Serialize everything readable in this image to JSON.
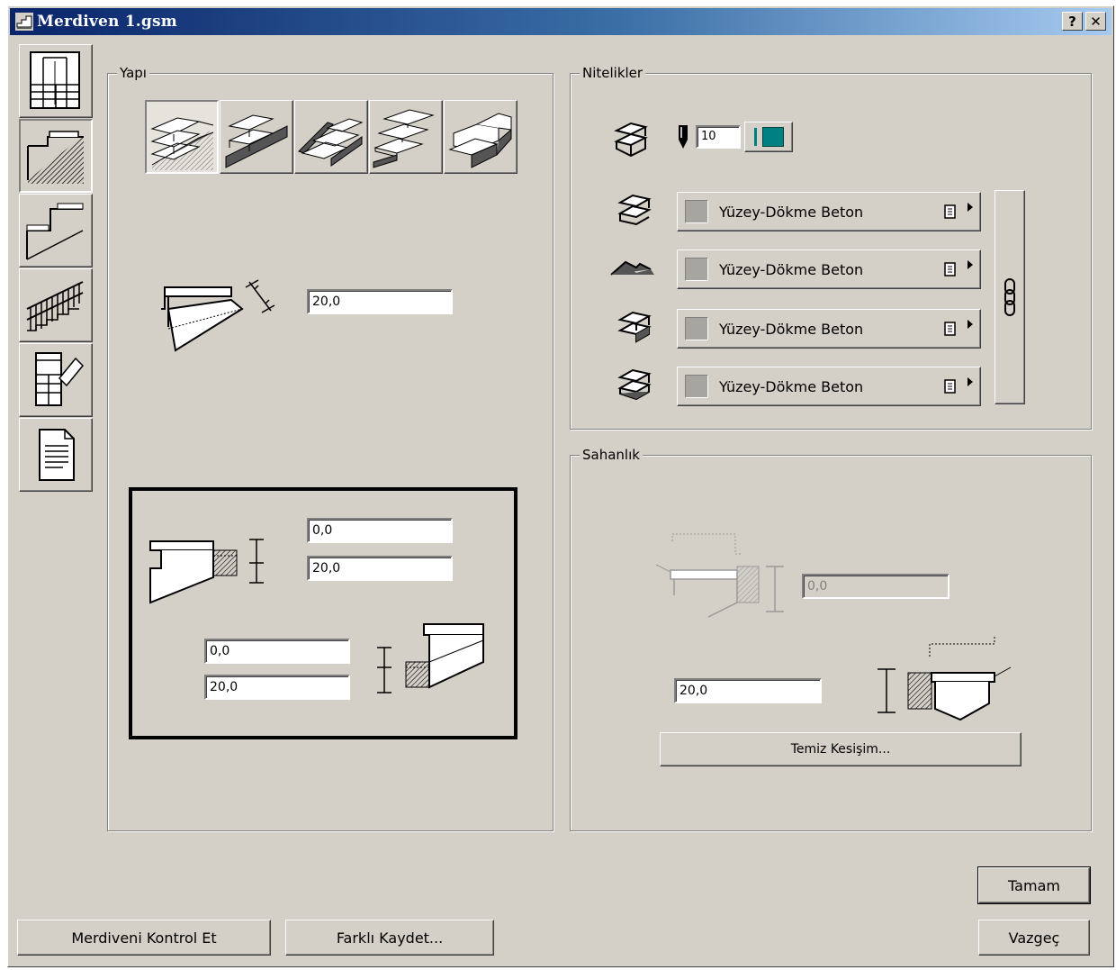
{
  "window": {
    "title": "Merdiven 1.gsm",
    "help_label": "?",
    "close_label": "✕"
  },
  "tabs": [
    {
      "name": "plan-view",
      "icon": "plan-view-icon"
    },
    {
      "name": "structure",
      "icon": "stair-structure-icon",
      "active": true
    },
    {
      "name": "stringer",
      "icon": "stringer-icon"
    },
    {
      "name": "railing",
      "icon": "railing-icon"
    },
    {
      "name": "plan-symbol",
      "icon": "plan-edit-icon"
    },
    {
      "name": "listing",
      "icon": "document-icon"
    }
  ],
  "yapi": {
    "title": "Yapı",
    "structure_types": [
      {
        "name": "solid-stair",
        "selected": true
      },
      {
        "name": "stringer-stair",
        "selected": false
      },
      {
        "name": "open-tread-stair",
        "selected": false
      },
      {
        "name": "cantilever-stair",
        "selected": false
      },
      {
        "name": "block-stair",
        "selected": false
      }
    ],
    "thickness": "20,0",
    "bottom_top": "0,0",
    "bottom_bottom": "20,0",
    "top_top": "0,0",
    "top_bottom": "20,0"
  },
  "nitelikler": {
    "title": "Nitelikler",
    "pen_value": "10",
    "accent_color": "#008080",
    "materials": [
      {
        "label": "Yüzey-Dökme Beton"
      },
      {
        "label": "Yüzey-Dökme Beton"
      },
      {
        "label": "Yüzey-Dökme Beton"
      },
      {
        "label": "Yüzey-Dökme Beton"
      }
    ]
  },
  "sahanlik": {
    "title": "Sahanlık",
    "top_value": "0,0",
    "bottom_value": "20,0",
    "clean_cut_label": "Temiz Kesişim..."
  },
  "footer": {
    "check_label": "Merdiveni Kontrol Et",
    "save_as_label": "Farklı Kaydet...",
    "ok_label": "Tamam",
    "cancel_label": "Vazgeç"
  }
}
